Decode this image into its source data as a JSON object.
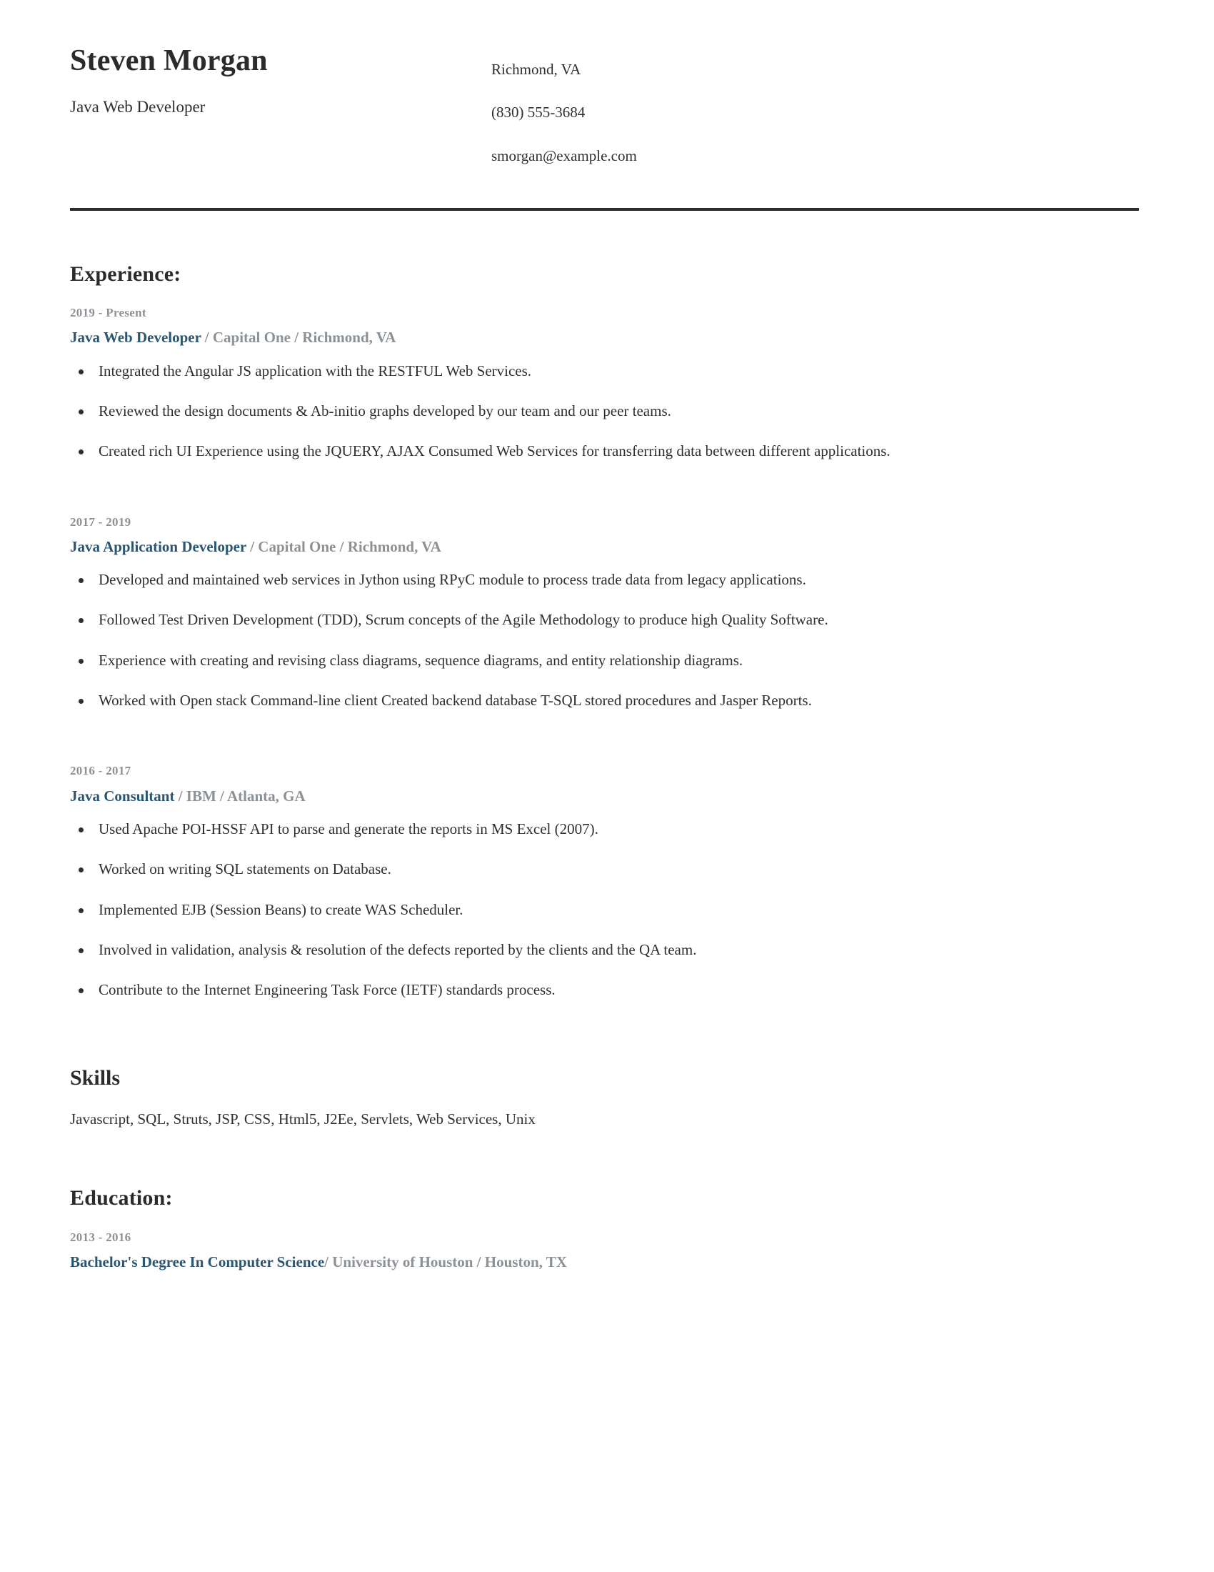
{
  "header": {
    "name": "Steven Morgan",
    "job_title": "Java Web Developer",
    "contact": {
      "location": "Richmond, VA",
      "phone": "(830) 555-3684",
      "email": "smorgan@example.com"
    }
  },
  "colors": {
    "heading": "#2b2b2b",
    "role_accent": "#2b5671",
    "meta_gray": "#8c9196",
    "body_text": "#2f2f2f",
    "divider": "#2b2b2b",
    "background": "#ffffff"
  },
  "experience": {
    "heading": "Experience:",
    "jobs": [
      {
        "dates": "2019 - Present",
        "role": "Java Web Developer",
        "meta": " / Capital One / Richmond, VA",
        "bullets": [
          "Integrated the Angular JS application with the RESTFUL Web Services.",
          "Reviewed the design documents & Ab-initio graphs developed by our team and our peer teams.",
          "Created rich UI Experience using the JQUERY, AJAX Consumed Web Services for transferring data between different applications."
        ]
      },
      {
        "dates": "2017 - 2019",
        "role": "Java Application Developer",
        "meta": " / Capital One / Richmond, VA",
        "bullets": [
          "Developed and maintained web services in Jython using RPyC module to process trade data from legacy applications.",
          "Followed Test Driven Development (TDD), Scrum concepts of the Agile Methodology to produce high Quality Software.",
          "Experience with creating and revising class diagrams, sequence diagrams, and entity relationship diagrams.",
          "Worked with Open stack Command-line client Created backend database T-SQL stored procedures and Jasper Reports."
        ]
      },
      {
        "dates": "2016 - 2017",
        "role": "Java Consultant",
        "meta": " / IBM / Atlanta, GA",
        "bullets": [
          "Used Apache POI-HSSF API to parse and generate the reports in MS Excel (2007).",
          "Worked on writing SQL statements on Database.",
          "Implemented EJB (Session Beans) to create WAS Scheduler.",
          "Involved in validation, analysis & resolution of the defects reported by the clients and the QA team.",
          "Contribute to the Internet Engineering Task Force (IETF) standards process."
        ]
      }
    ]
  },
  "skills": {
    "heading": "Skills",
    "text": "Javascript, SQL, Struts, JSP, CSS, Html5, J2Ee, Servlets, Web Services, Unix"
  },
  "education": {
    "heading": "Education:",
    "entries": [
      {
        "dates": "2013 - 2016",
        "degree": "Bachelor's Degree In Computer Science",
        "meta": "/ University of Houston / Houston, TX"
      }
    ]
  }
}
